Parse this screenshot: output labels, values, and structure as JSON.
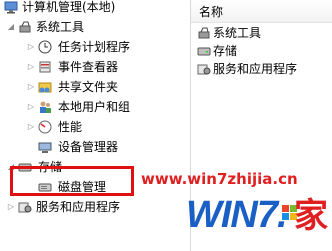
{
  "tree": {
    "root": "计算机管理(本地)",
    "system_tools": "系统工具",
    "children": [
      "任务计划程序",
      "事件查看器",
      "共享文件夹",
      "本地用户和组",
      "性能",
      "设备管理器"
    ],
    "storage": "存储",
    "disk_management": "磁盘管理",
    "services": "服务和应用程序"
  },
  "list": {
    "header": "名称",
    "items": [
      "系统工具",
      "存储",
      "服务和应用程序"
    ]
  },
  "watermark": {
    "url": "www.win7zhijia.cn",
    "logo": "WIN7.",
    "jia": "家"
  },
  "colors": {
    "highlight_box": "#e01010",
    "watermark_red": "#e02020",
    "logo_blue": "#1a5fc4"
  }
}
